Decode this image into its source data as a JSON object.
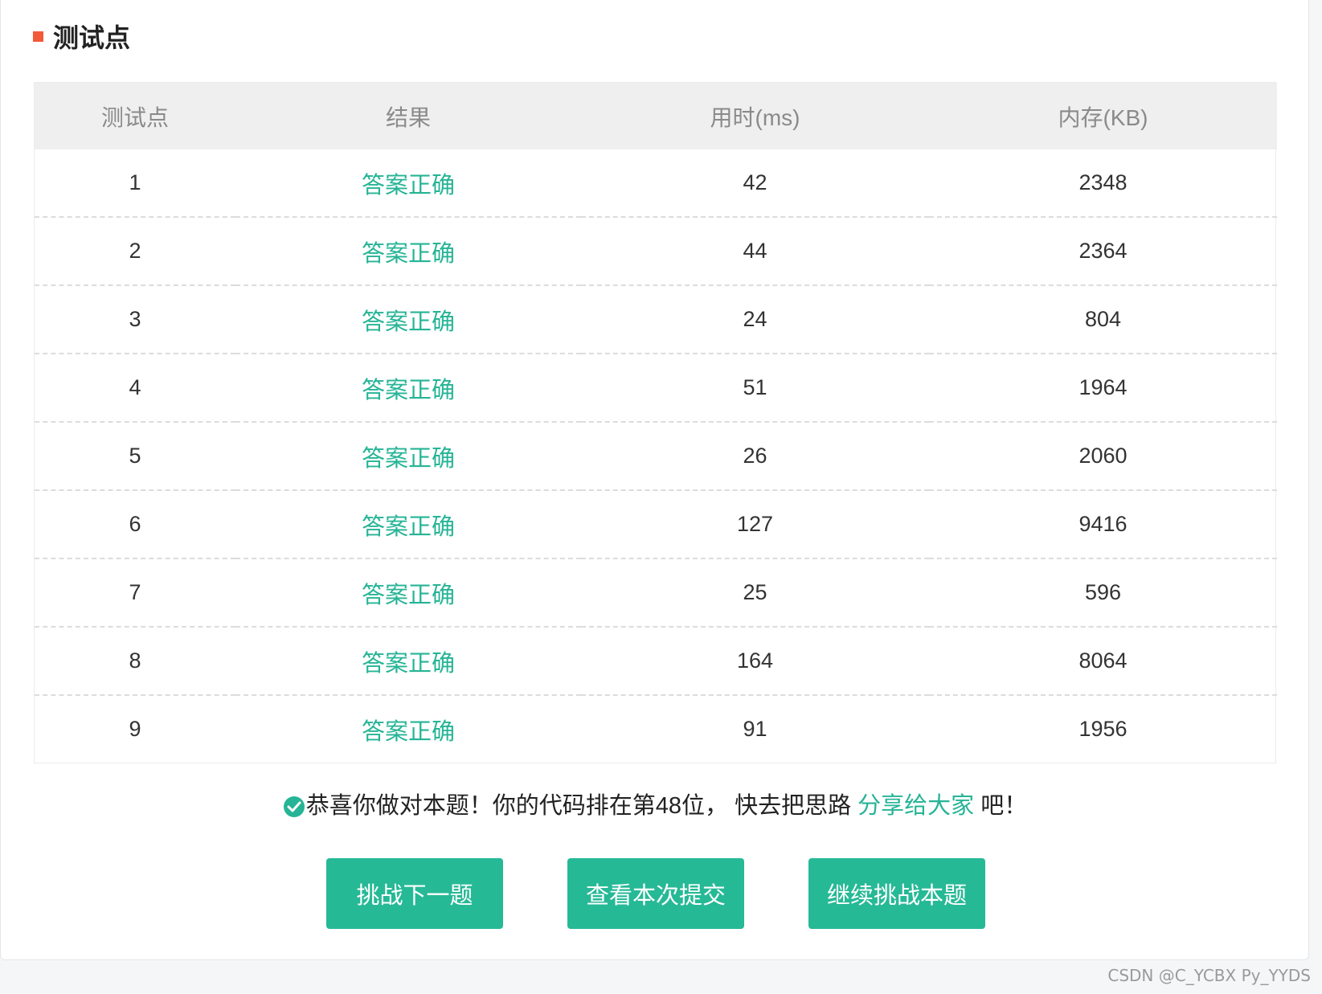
{
  "section": {
    "title": "测试点"
  },
  "table": {
    "headers": [
      "测试点",
      "结果",
      "用时(ms)",
      "内存(KB)"
    ],
    "rows": [
      {
        "id": "1",
        "result": "答案正确",
        "time": "42",
        "memory": "2348"
      },
      {
        "id": "2",
        "result": "答案正确",
        "time": "44",
        "memory": "2364"
      },
      {
        "id": "3",
        "result": "答案正确",
        "time": "24",
        "memory": "804"
      },
      {
        "id": "4",
        "result": "答案正确",
        "time": "51",
        "memory": "1964"
      },
      {
        "id": "5",
        "result": "答案正确",
        "time": "26",
        "memory": "2060"
      },
      {
        "id": "6",
        "result": "答案正确",
        "time": "127",
        "memory": "9416"
      },
      {
        "id": "7",
        "result": "答案正确",
        "time": "25",
        "memory": "596"
      },
      {
        "id": "8",
        "result": "答案正确",
        "time": "164",
        "memory": "8064"
      },
      {
        "id": "9",
        "result": "答案正确",
        "time": "91",
        "memory": "1956"
      }
    ]
  },
  "message": {
    "prefix": "恭喜你做对本题！你的代码排在第48位，  快去把思路 ",
    "link": "分享给大家",
    "suffix": " 吧！",
    "icon": "check-circle-icon"
  },
  "buttons": {
    "next": "挑战下一题",
    "view": "查看本次提交",
    "retry": "继续挑战本题"
  },
  "watermark": "CSDN @C_YCBX Py_YYDS",
  "colors": {
    "accent": "#26b496",
    "title_mark": "#f25a38"
  }
}
